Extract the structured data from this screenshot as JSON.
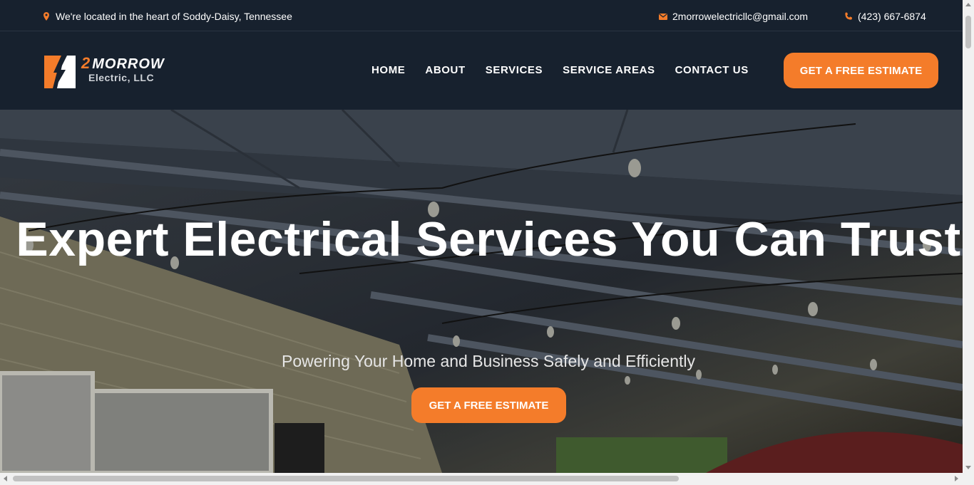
{
  "topbar": {
    "location": "We're located in the heart of Soddy-Daisy, Tennessee",
    "email": "2morrowelectricllc@gmail.com",
    "phone": "(423) 667-6874",
    "icons": [
      "map-pin-icon",
      "envelope-icon",
      "phone-icon"
    ]
  },
  "logo": {
    "number": "2",
    "brand": "MORROW",
    "subtitle": "Electric, LLC"
  },
  "nav": {
    "items": [
      "HOME",
      "ABOUT",
      "SERVICES",
      "SERVICE AREAS",
      "CONTACT US"
    ]
  },
  "header_cta": "GET A FREE ESTIMATE",
  "hero": {
    "title": "Expert Electrical Services You Can Trust",
    "subtitle": "Powering Your Home and Business Safely and Efficiently",
    "cta": "GET A FREE ESTIMATE"
  },
  "colors": {
    "accent": "#f47c2a",
    "header_bg": "#17212e",
    "text": "#ffffff"
  }
}
